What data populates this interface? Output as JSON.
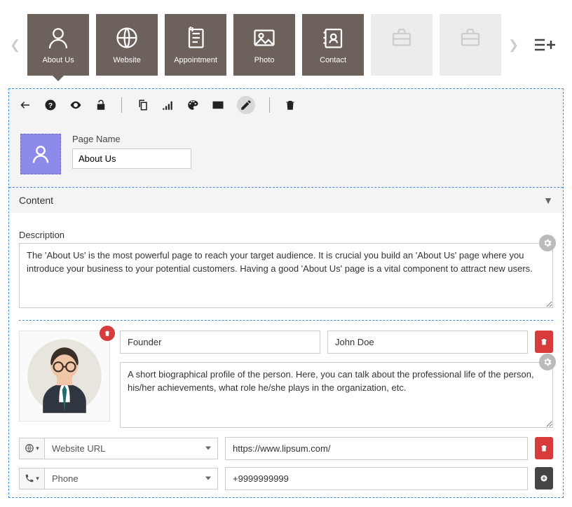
{
  "tabs": [
    {
      "label": "About Us",
      "icon": "user-icon",
      "active": true
    },
    {
      "label": "Website",
      "icon": "globe-icon",
      "active": false
    },
    {
      "label": "Appointment",
      "icon": "clipboard-icon",
      "active": false
    },
    {
      "label": "Photo",
      "icon": "photo-icon",
      "active": false
    },
    {
      "label": "Contact",
      "icon": "address-book-icon",
      "active": false
    }
  ],
  "emptyTabs": 2,
  "toolbarIcons": [
    "back",
    "help",
    "eye",
    "unlock",
    "copy",
    "signal",
    "palette",
    "card",
    "edit",
    "trash"
  ],
  "pageName": {
    "label": "Page Name",
    "value": "About Us"
  },
  "accordion": {
    "title": "Content"
  },
  "description": {
    "label": "Description",
    "value": "The 'About Us' is the most powerful page to reach your target audience. It is crucial you build an 'About Us' page where you introduce your business to your potential customers. Having a good 'About Us' page is a vital component to attract new users."
  },
  "person": {
    "role": "Founder",
    "name": "John Doe",
    "bio": "A short biographical profile of the person. Here, you can talk about the professional life of the person, his/her achievements, what role he/she plays in the organization, etc."
  },
  "contacts": [
    {
      "typeIcon": "globe",
      "typeLabel": "Website URL",
      "value": "https://www.lipsum.com/",
      "action": "delete"
    },
    {
      "typeIcon": "phone",
      "typeLabel": "Phone",
      "value": "+9999999999",
      "action": "add"
    }
  ]
}
